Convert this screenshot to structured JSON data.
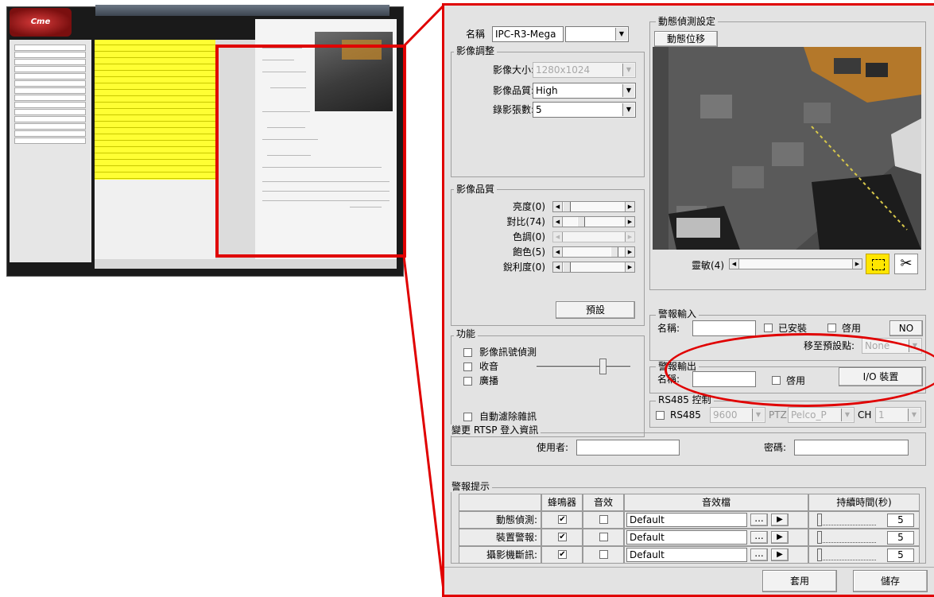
{
  "thumbnail": {
    "logo_text": "Cme",
    "menu_item_count": 14,
    "list_row_count": 22
  },
  "settings": {
    "name_label": "名稱",
    "name_value": "IPC-R3-Mega",
    "name_dropdown_value": ""
  },
  "image_adjust": {
    "title": "影像調整",
    "size_label": "影像大小:",
    "size_value": "1280x1024",
    "quality_label": "影像品質:",
    "quality_value": "High",
    "rec_rate_label": "錄影張數:",
    "rec_rate_value": "5"
  },
  "image_quality": {
    "title": "影像品質",
    "sliders": [
      {
        "label": "亮度(0)",
        "position": 0.0,
        "enabled": true
      },
      {
        "label": "對比(74)",
        "position": 0.25,
        "enabled": true
      },
      {
        "label": "色調(0)",
        "position": 0.0,
        "enabled": false
      },
      {
        "label": "飽色(5)",
        "position": 0.85,
        "enabled": true
      },
      {
        "label": "銳利度(0)",
        "position": 0.0,
        "enabled": true
      }
    ],
    "default_button": "預設"
  },
  "functions": {
    "title": "功能",
    "items": [
      {
        "label": "影像訊號偵測",
        "checked": false
      },
      {
        "label": "收音",
        "checked": false
      },
      {
        "label": "廣播",
        "checked": false
      }
    ],
    "volume_level": 0.7,
    "denoise_label": "自動濾除雜訊",
    "denoise_checked": false
  },
  "motion": {
    "title": "動態偵測設定",
    "tab_label": "動態位移",
    "sensitivity_label": "靈敏(4)"
  },
  "alarm_in": {
    "title": "警報輸入",
    "name_label": "名稱:",
    "name_value": "",
    "installed_label": "已安裝",
    "enable_label": "啓用",
    "state_value": "NO",
    "preset_label": "移至預設點:",
    "preset_value": "None"
  },
  "alarm_out": {
    "title": "警報輸出",
    "name_label": "名稱:",
    "name_value": "",
    "enable_label": "啓用",
    "io_button": "I/O 裝置"
  },
  "rs485": {
    "title": "RS485 控制",
    "check_label": "RS485",
    "baud_value": "9600",
    "ptz_label": "PTZ",
    "ptz_value": "Pelco_P",
    "ch_label": "CH",
    "ch_value": "1"
  },
  "rtsp": {
    "title": "變更 RTSP 登入資訊",
    "user_label": "使用者:",
    "user_value": "",
    "password_label": "密碼:",
    "password_value": ""
  },
  "alarm_notice": {
    "title": "警報提示",
    "headers": [
      "蜂鳴器",
      "音效",
      "音效檔",
      "持續時間(秒)"
    ],
    "rows": [
      {
        "label": "動態偵測:",
        "buzzer": true,
        "sound": false,
        "file": "Default",
        "duration": "5"
      },
      {
        "label": "裝置警報:",
        "buzzer": true,
        "sound": false,
        "file": "Default",
        "duration": "5"
      },
      {
        "label": "攝影機斷訊:",
        "buzzer": true,
        "sound": false,
        "file": "Default",
        "duration": "5"
      }
    ],
    "browse_label": "..."
  },
  "footer": {
    "apply_button": "套用",
    "save_button": "儲存"
  },
  "colors": {
    "highlight": "#e00000",
    "thumb_list": "#ffff33",
    "selected_tool": "#ffe600"
  }
}
